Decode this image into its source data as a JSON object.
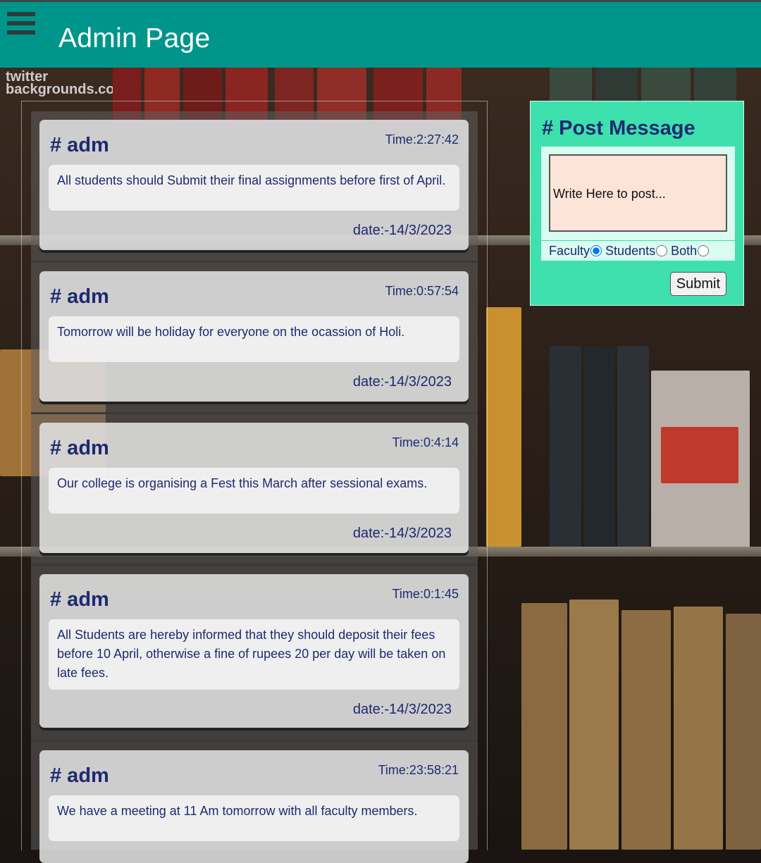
{
  "header": {
    "title": "Admin Page",
    "menu_icon": "hamburger-menu-icon"
  },
  "background": {
    "watermark_line1": "twitter",
    "watermark_line2": "backgrounds.com"
  },
  "posts": [
    {
      "author": "# adm",
      "time": "Time:2:27:42",
      "message": "All students should Submit their final assignments before first of April.",
      "date": "date:-14/3/2023"
    },
    {
      "author": "# adm",
      "time": "Time:0:57:54",
      "message": "Tomorrow will be holiday for everyone on the ocassion of Holi.",
      "date": "date:-14/3/2023"
    },
    {
      "author": "# adm",
      "time": "Time:0:4:14",
      "message": "Our college is organising a Fest this March after sessional exams.",
      "date": "date:-14/3/2023"
    },
    {
      "author": "# adm",
      "time": "Time:0:1:45",
      "message": "All Students are hereby informed that they should deposit their fees before 10 April, otherwise a fine of rupees 20 per day will be taken on late fees.",
      "date": "date:-14/3/2023"
    },
    {
      "author": "# adm",
      "time": "Time:23:58:21",
      "message": "We have a meeting at 11 Am tomorrow with all faculty members.",
      "date": ""
    }
  ],
  "post_panel": {
    "title": "# Post Message",
    "placeholder": "Write Here to post...",
    "options": [
      "Faculty",
      "Students",
      "Both"
    ],
    "selected_option": "Faculty",
    "submit_label": "Submit"
  },
  "colors": {
    "appbar": "#00958a",
    "panel": "#3ee0ad",
    "text_primary": "#1e2a70"
  }
}
